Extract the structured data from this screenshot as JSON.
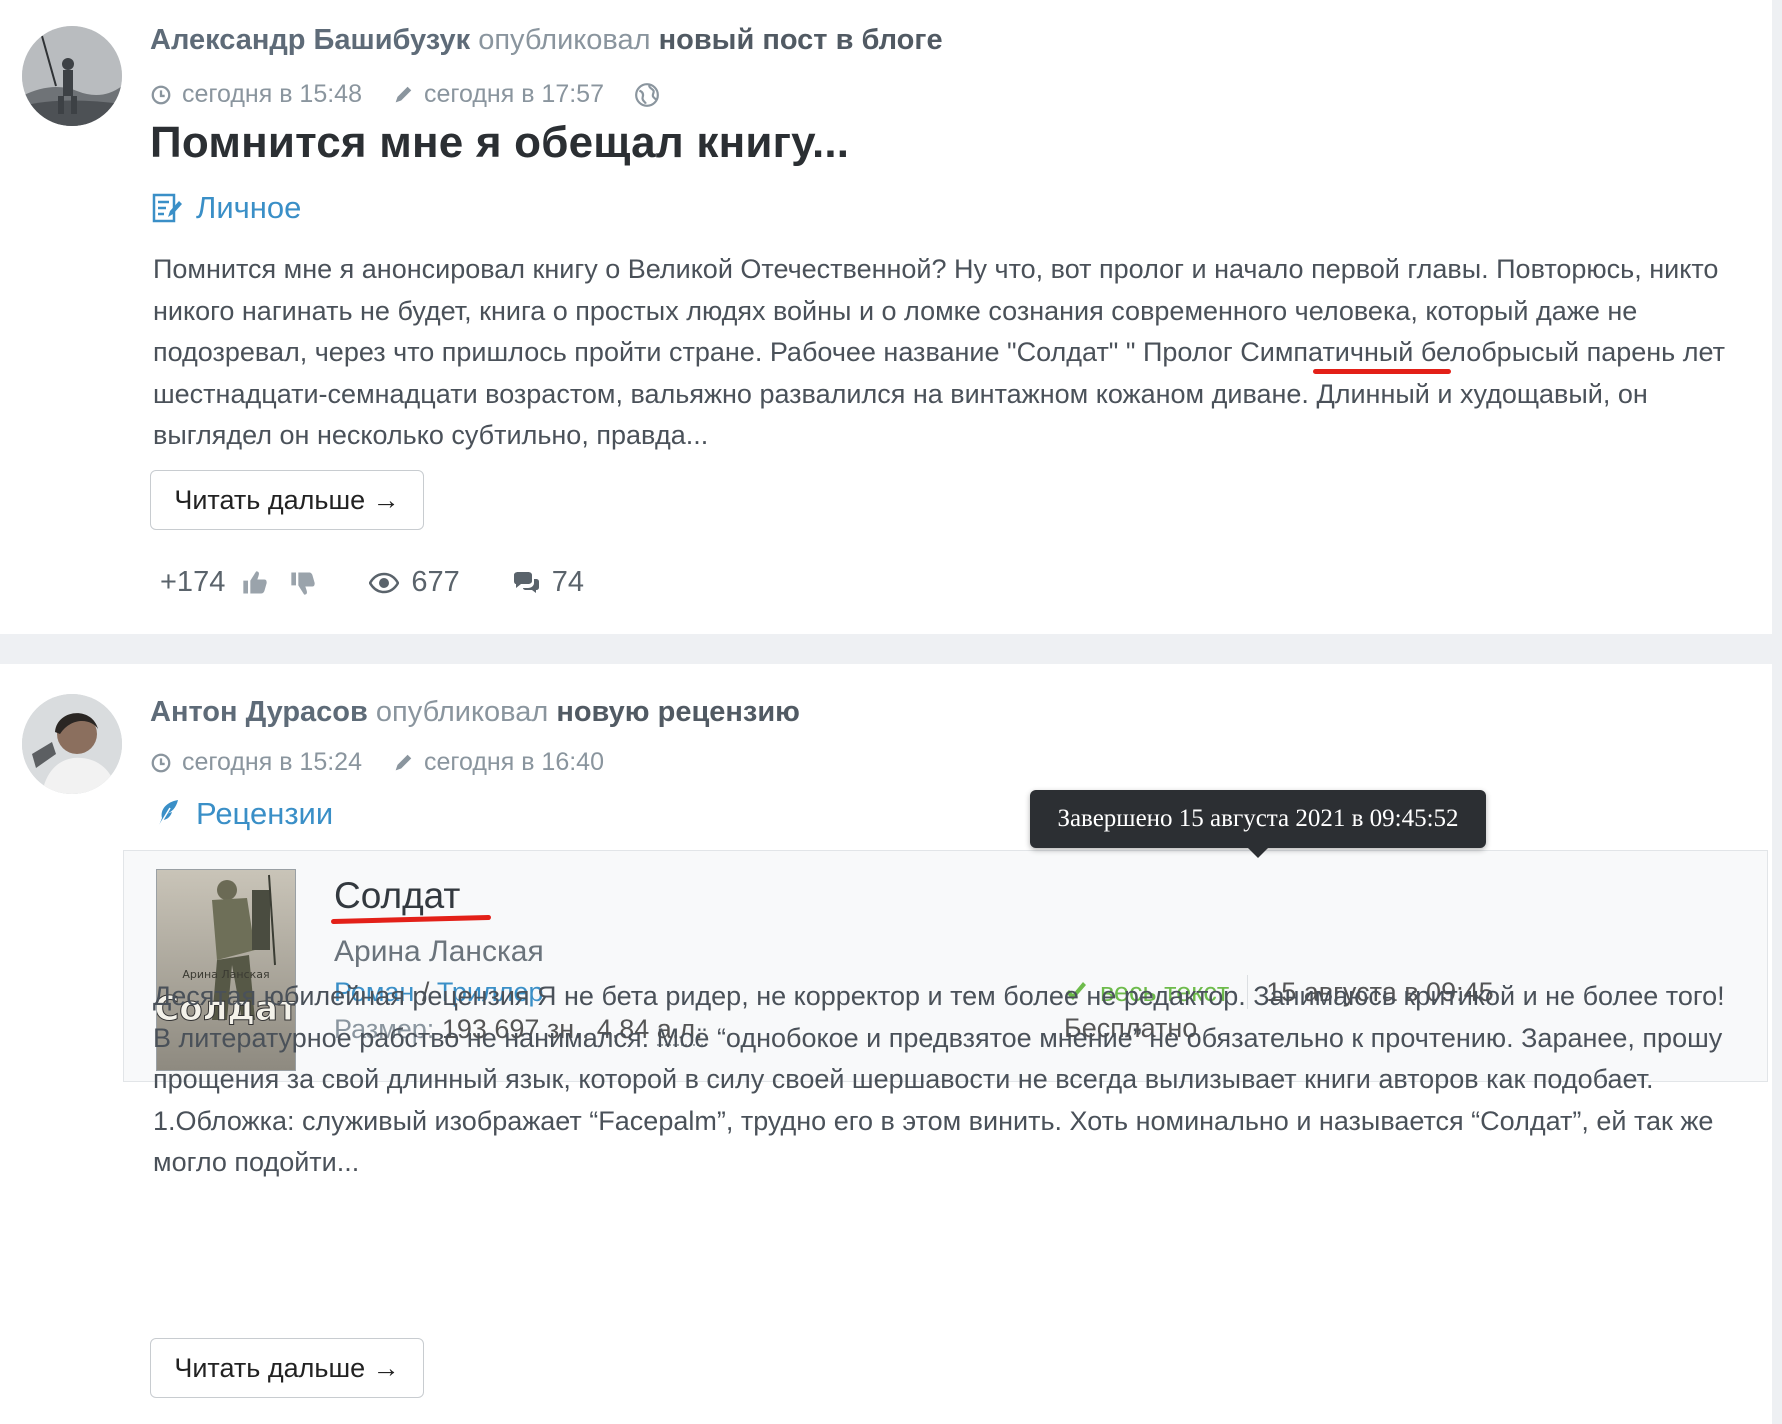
{
  "posts": [
    {
      "author": "Александр Башибузук",
      "published": "опубликовал",
      "post_type": "новый пост в блоге",
      "created": "сегодня в 15:48",
      "edited": "сегодня в 17:57",
      "title": "Помнится мне я обещал книгу...",
      "category": "Личное",
      "excerpt": "Помнится мне я анонсировал книгу о Великой Отечественной? Ну что, вот пролог и начало первой главы. Повто­рюсь, никто никого нагинать не будет, книга о простых людях войны и о ломке сознания современного человека, который даже не подозревал, через что пришлось пройти стране. Рабочее название \"Солдат\" \" Пролог Симпатич­ный белобрысый парень лет шестнадцати-семнадцати возрастом, вальяжно развалился на винтажном кожаном диване. Длинный и худощавый, он выглядел он несколько субтильно, правда...",
      "read_more": "Читать дальше →",
      "rating": "+174",
      "views": "677",
      "comments": "74"
    },
    {
      "author": "Антон Дурасов",
      "published": "опубликовал",
      "post_type": "новую рецензию",
      "created": "сегодня в 15:24",
      "edited": "сегодня в 16:40",
      "category": "Рецензии",
      "book": {
        "title": "Солдат",
        "author": "Арина Ланская",
        "genre1": "Роман",
        "genre_sep": "/",
        "genre2": "Триллер",
        "size_label": "Размер:",
        "size_value": "193 697 зн., 4,84",
        "size_unit": "а.л.",
        "status": "весь текст",
        "status_date": "15 августа в 09:45",
        "price": "Бесплатно",
        "tooltip": "Завершено 15 августа 2021 в 09:45:52",
        "cover_author": "Арина Ланская",
        "cover_title": "Солдат"
      },
      "excerpt": "Десятая юбилейная рецензия Я не бета ридер, не корректор и тем более не редактор. Занимаюсь критикой и не более того! В литературное рабство не нанимался. Моё “однобокое и предвзятое мнение” не обязательно к про­чтению. Заранее, прошу прощения за свой длинный язык, которой в силу своей шершавости не всегда вылизывает книги авторов как подобает. 1.Обложка: служивый изображает “Facepalm”, трудно его в этом винить. Хоть номи­нально и называется “Солдат”, ей так же могло подойти...",
      "read_more": "Читать дальше →"
    }
  ],
  "icons": {
    "clock": "clock-icon",
    "pencil": "pencil-icon",
    "globe": "globe-icon",
    "blog": "blog-notepad-icon",
    "review": "feather-icon",
    "like": "thumbs-up-icon",
    "dislike": "thumbs-down-icon",
    "views": "eye-icon",
    "comments": "comments-icon",
    "check": "check-icon"
  },
  "colors": {
    "link": "#3a8fc7",
    "annotation": "#e32018",
    "success": "#6dbb4b"
  }
}
